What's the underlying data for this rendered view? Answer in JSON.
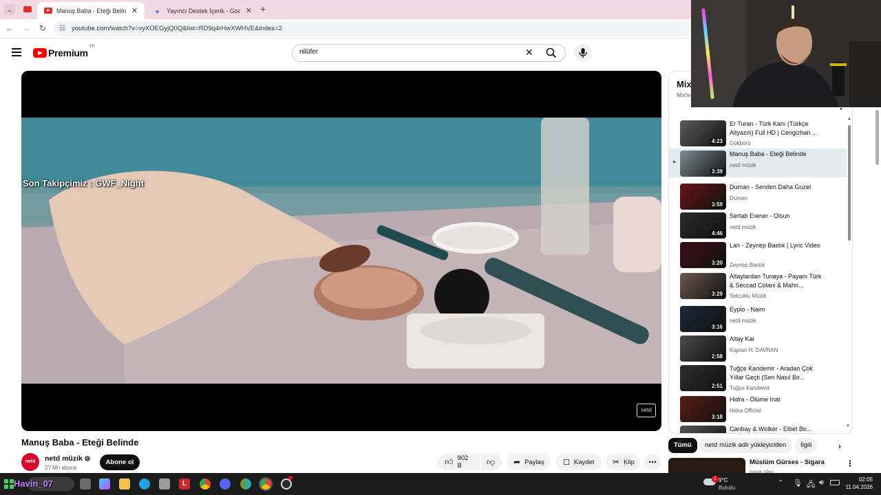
{
  "browser": {
    "tabs": [
      {
        "label": "Manuş Baba - Eteği Belinde - Yo"
      },
      {
        "label": "Yayıncı Destek İçerik - Google C"
      }
    ],
    "url": "youtube.com/watch?v=vyXOEGyjQ0Q&list=RD9q4rHwXWHVE&index=2"
  },
  "header": {
    "logo": "Premium",
    "logo_region": "TR",
    "search_value": "nilüfer"
  },
  "player": {
    "overlay_text": "Son Takipçimiz : GWF_Night",
    "watermark": "netd"
  },
  "video": {
    "title": "Manuş Baba - Eteği Belinde",
    "channel": "netd müzik",
    "subscribers": "27 Mn abone",
    "subscribe_label": "Abone ol",
    "like_count": "902 B",
    "share_label": "Paylaş",
    "save_label": "Kaydet",
    "clip_label": "Klip"
  },
  "playlist": {
    "title": "Mix",
    "subtitle": "Mix'le",
    "items": [
      {
        "title": "Er Turan - Türk Kanı (Türkçe Altyazılı) Full HD | Cengizhan ...",
        "channel": "Gökbörü",
        "duration": "4:23",
        "color": "#5c5c5c"
      },
      {
        "title": "Manuş Baba - Eteği Belinde",
        "channel": "netd müzik",
        "duration": "3:39",
        "color": "#7c8c93"
      },
      {
        "title": "Duman - Senden Daha Guzel",
        "channel": "Duman",
        "duration": "3:59",
        "color": "#6a1414"
      },
      {
        "title": "Sertab Erener - Olsun",
        "channel": "netd müzik",
        "duration": "4:46",
        "color": "#2b2b2b"
      },
      {
        "title": "Lan - Zeynep Bastık | Lyric Video",
        "channel": "Zeynep Bastık",
        "duration": "3:20",
        "color": "#3a0e12"
      },
      {
        "title": "Altaylardan Tunaya - Payam Türk & Seccad Colani & Mahn...",
        "channel": "Selçuklu Müzik",
        "duration": "3:29",
        "color": "#6b5a4c"
      },
      {
        "title": "Eypio - Naim",
        "channel": "netd müzik",
        "duration": "3:16",
        "color": "#1b2a3a"
      },
      {
        "title": "Altay Kai",
        "channel": "Kaptan H. DAVRAN",
        "duration": "2:58",
        "color": "#4a4a4a"
      },
      {
        "title": "Tuğçe Kandemir - Aradan Çok Yıllar Geçti (Sen Nasıl Bir...",
        "channel": "Tuğçe Kandemir",
        "duration": "2:51",
        "color": "#2e2e2e"
      },
      {
        "title": "Hidra - Ölüme İnat",
        "channel": "Hidra Official",
        "duration": "3:18",
        "color": "#5a1e16"
      },
      {
        "title": "Canbay & Wolker - Elbet Bir...",
        "channel": "",
        "duration": "",
        "color": "#555555"
      }
    ]
  },
  "chips": [
    "Tümü",
    "netd müzik adlı yükleyiciden",
    "İlgili"
  ],
  "related": {
    "title": "Müslüm Gürses - Sigara",
    "channel": "naga play"
  },
  "taskbar": {
    "overlay_text": "Havin_07",
    "weather_temp": "9°C",
    "weather_desc": "Bulutlu",
    "time": "02:05",
    "date": "11.04.2026",
    "badge": "1"
  }
}
